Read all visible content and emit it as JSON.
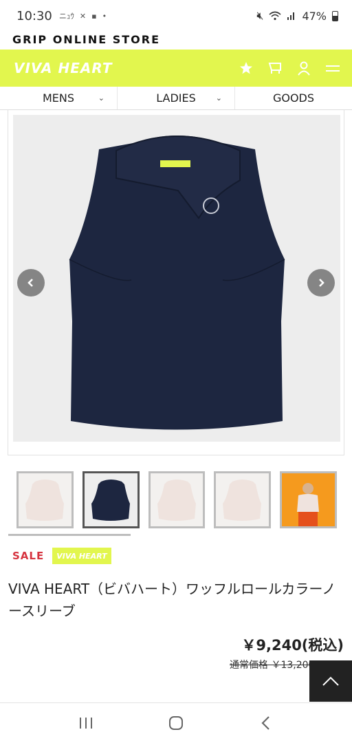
{
  "statusbar": {
    "time": "10:30",
    "notif_icons": [
      "notification-icon",
      "tools-icon",
      "app-icon",
      "dot-icon"
    ],
    "battery": "47%"
  },
  "store": {
    "title": "GRIP ONLINE STORE"
  },
  "brandbar": {
    "logo_text": "VIVA HEART",
    "color": "#e2f64e",
    "icons": [
      "star-icon",
      "cart-icon",
      "user-icon",
      "menu-icon"
    ]
  },
  "categories": [
    {
      "label": "MENS",
      "has_dropdown": true
    },
    {
      "label": "LADIES",
      "has_dropdown": true
    },
    {
      "label": "GOODS",
      "has_dropdown": false
    }
  ],
  "gallery": {
    "prev_icon": "chevron-left-icon",
    "next_icon": "chevron-right-icon",
    "thumbnails": [
      {
        "kind": "white-vest",
        "active": false
      },
      {
        "kind": "navy-vest",
        "active": true
      },
      {
        "kind": "white-vest",
        "active": false
      },
      {
        "kind": "white-vest",
        "active": false
      },
      {
        "kind": "model-photo",
        "active": false
      }
    ]
  },
  "product": {
    "sale_label": "SALE",
    "brand_tag": "VIVA HEART",
    "name": "VIVA HEART（ビバハート）ワッフルロールカラーノースリーブ",
    "price": "￥9,240(税込)",
    "regular_price": "通常価格 ￥13,200"
  },
  "android_nav": [
    "recents-icon",
    "home-icon",
    "back-icon"
  ]
}
